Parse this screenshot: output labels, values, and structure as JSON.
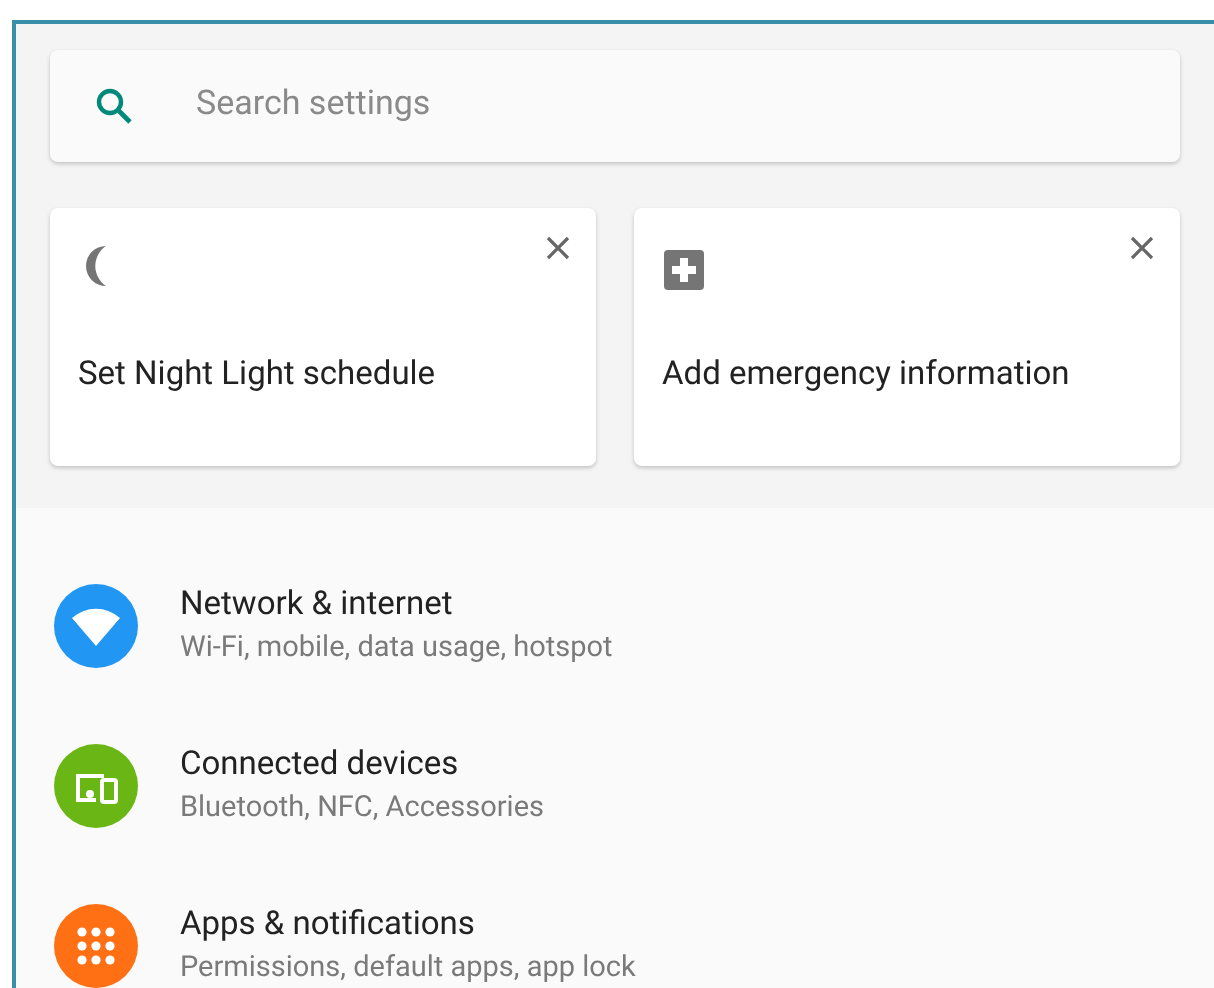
{
  "search": {
    "placeholder": "Search settings"
  },
  "suggestions": [
    {
      "kind": "moon",
      "title": "Set Night Light schedule"
    },
    {
      "kind": "medical",
      "title": "Add emergency information"
    }
  ],
  "categories": [
    {
      "kind": "wifi",
      "color": "#2196f3",
      "title": "Network & internet",
      "summary": "Wi-Fi, mobile, data usage, hotspot"
    },
    {
      "kind": "devices",
      "color": "#6ab614",
      "title": "Connected devices",
      "summary": "Bluetooth, NFC, Accessories"
    },
    {
      "kind": "apps",
      "color": "#ff7014",
      "title": "Apps & notifications",
      "summary": "Permissions, default apps, app lock"
    }
  ]
}
